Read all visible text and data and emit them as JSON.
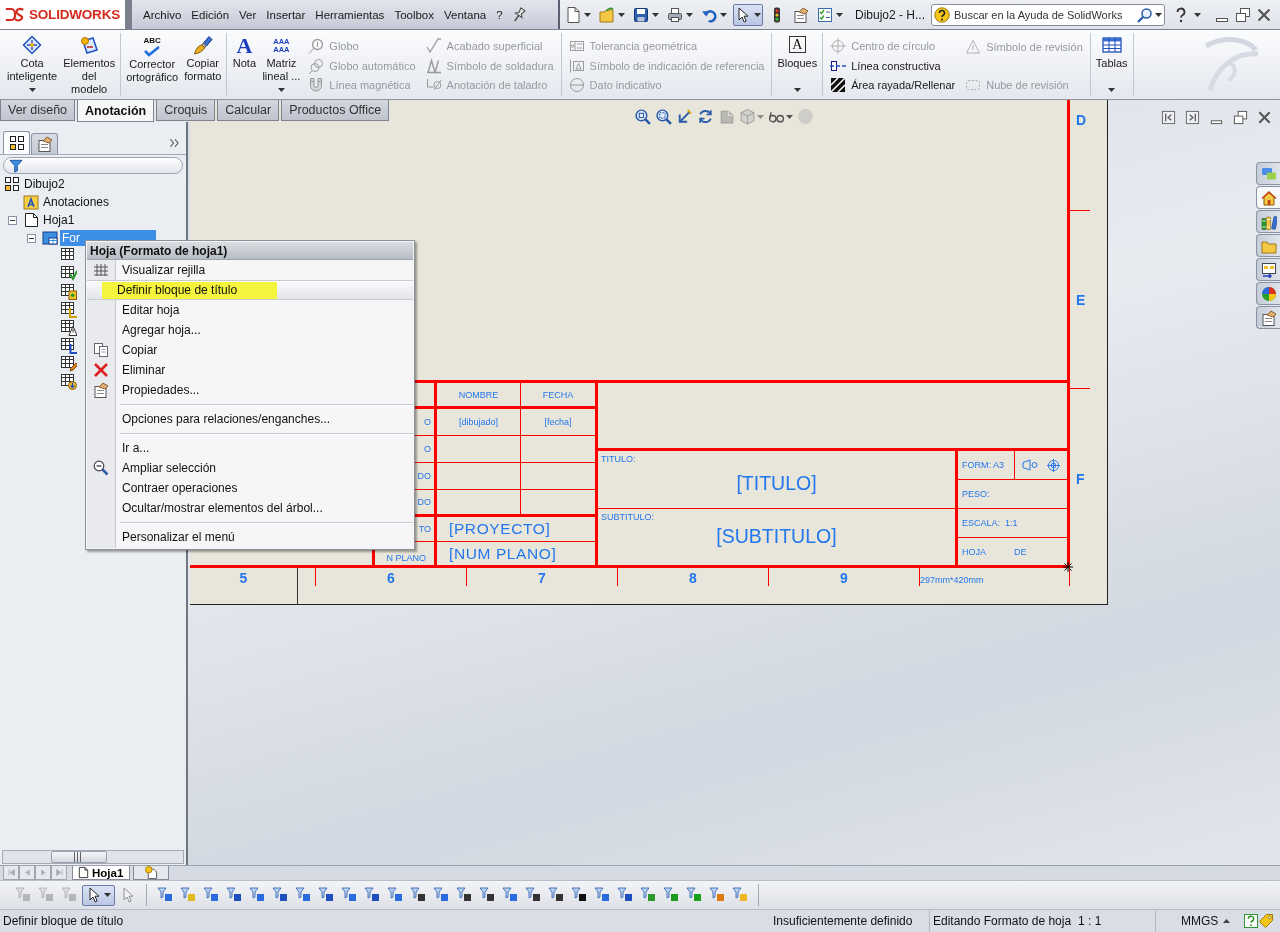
{
  "title_bar": {
    "logo": "SOLIDWORKS",
    "menu": [
      "Archivo",
      "Edición",
      "Ver",
      "Insertar",
      "Herramientas",
      "Toolbox",
      "Ventana",
      "?"
    ],
    "quick_access": [
      {
        "kind": "new",
        "dropdown": true,
        "on": false
      },
      {
        "kind": "open",
        "dropdown": true,
        "on": false
      },
      {
        "kind": "save",
        "dropdown": true,
        "on": false
      },
      {
        "kind": "print",
        "dropdown": true,
        "on": false
      },
      {
        "kind": "undo",
        "dropdown": true,
        "on": false
      },
      {
        "kind": "select",
        "dropdown": true,
        "on": true
      },
      {
        "kind": "traffic_light",
        "dropdown": false,
        "on": false
      },
      {
        "kind": "options",
        "dropdown": false,
        "on": false
      },
      {
        "kind": "checklist",
        "dropdown": true,
        "on": false
      }
    ],
    "document_title": "Dibujo2 - H...",
    "search": {
      "placeholder": "Buscar en la Ayuda de SolidWorks"
    }
  },
  "ribbon": {
    "groups": [
      {
        "buttons": [
          {
            "kind": "smart_dimension",
            "lines": [
              "Cota",
              "inteligente"
            ],
            "dropdown": true
          },
          {
            "kind": "model_items",
            "lines": [
              "Elementos",
              "del",
              "modelo"
            ],
            "dropdown": false
          }
        ]
      },
      {
        "buttons": [
          {
            "kind": "spell_check",
            "glyph": [
              "ABC"
            ],
            "lines": [
              "Corrector",
              "ortográfico"
            ],
            "dropdown": false
          },
          {
            "kind": "format_painter",
            "lines": [
              "Copiar",
              "formato"
            ],
            "dropdown": false
          }
        ]
      },
      {
        "buttons": [
          {
            "kind": "note",
            "glyph": [
              "A"
            ],
            "lines": [
              "Nota"
            ],
            "dropdown": false
          },
          {
            "kind": "pattern",
            "glyph": [
              "AAA",
              "AAA"
            ],
            "lines": [
              "Matriz",
              "lineal ..."
            ],
            "dropdown": true
          }
        ],
        "columns": [
          [
            {
              "kind": "balloon",
              "label": "Globo",
              "disabled": true
            },
            {
              "kind": "auto_balloon",
              "label": "Globo automático",
              "disabled": true
            },
            {
              "kind": "magnetic_line",
              "label": "Línea magnética",
              "disabled": true
            }
          ],
          [
            {
              "kind": "surface_finish",
              "label": "Acabado superficial",
              "disabled": true
            },
            {
              "kind": "weld",
              "label": "Símbolo de soldadura",
              "disabled": true
            },
            {
              "kind": "hole_callout",
              "label": "Anotación de taladro",
              "disabled": true
            }
          ]
        ]
      },
      {
        "columns": [
          [
            {
              "kind": "tolerance",
              "label": "Tolerancia geométrica",
              "disabled": true
            },
            {
              "kind": "datum",
              "label": "Símbolo de indicación de referencia",
              "disabled": true
            },
            {
              "kind": "datum_target",
              "label": "Dato indicativo",
              "disabled": true
            }
          ]
        ]
      },
      {
        "buttons": [
          {
            "kind": "blocks",
            "glyph": [
              "A"
            ],
            "lines": [
              "Bloques"
            ],
            "dropdown": true
          }
        ]
      },
      {
        "columns": [
          [
            {
              "kind": "center_mark",
              "label": "Centro de círculo",
              "disabled": true
            },
            {
              "kind": "centerline",
              "label": "Línea constructiva",
              "disabled": false
            },
            {
              "kind": "hatch",
              "label": "Área rayada/Rellenar",
              "disabled": false
            }
          ],
          [
            {
              "kind": "revision_symbol",
              "label": "Símbolo de revisión",
              "disabled": true
            },
            {
              "kind": "revision_cloud",
              "label": "Nube de revisión",
              "disabled": true
            }
          ]
        ]
      },
      {
        "buttons": [
          {
            "kind": "tables",
            "lines": [
              "Tablas"
            ],
            "dropdown": true
          }
        ]
      }
    ]
  },
  "command_tabs": [
    {
      "label": "Ver diseño",
      "selected": false
    },
    {
      "label": "Anotación",
      "selected": true
    },
    {
      "label": "Croquis",
      "selected": false
    },
    {
      "label": "Calcular",
      "selected": false
    },
    {
      "label": "Productos Office",
      "selected": false
    }
  ],
  "feature_manager": {
    "tabs": [
      {
        "kind": "tree",
        "selected": true
      },
      {
        "kind": "properties",
        "selected": false
      }
    ],
    "tree": [
      {
        "kind": "drawing",
        "label": "Dibujo2",
        "selected": false,
        "children": [
          {
            "kind": "annotations",
            "label": "Anotaciones",
            "selected": false
          },
          {
            "kind": "sheet",
            "label": "Hoja1",
            "selected": false,
            "expanded": true,
            "children": [
              {
                "kind": "sheet_format",
                "label": "For",
                "selected": true,
                "expanded": true,
                "children": [
                  {
                    "kind": "table",
                    "selected": false
                  },
                  {
                    "kind": "table_check",
                    "selected": false
                  },
                  {
                    "kind": "table_box",
                    "selected": false
                  },
                  {
                    "kind": "table_chart",
                    "selected": false
                  },
                  {
                    "kind": "table_warning",
                    "selected": false
                  },
                  {
                    "kind": "table_angle",
                    "selected": false
                  },
                  {
                    "kind": "table_pencil",
                    "selected": false
                  },
                  {
                    "kind": "table_arrow",
                    "selected": false
                  }
                ]
              }
            ]
          }
        ]
      }
    ]
  },
  "context_menu": {
    "title": "Hoja (Formato de hoja1)",
    "items": [
      {
        "kind": "grid",
        "label": "Visualizar rejilla",
        "selected": false,
        "marked": false
      },
      {
        "kind": "plain",
        "label": "Definir bloque de título",
        "selected": true,
        "marked": true
      },
      {
        "kind": "plain",
        "label": "Editar hoja",
        "selected": false,
        "marked": false
      },
      {
        "kind": "plain",
        "label": "Agregar hoja...",
        "selected": false,
        "marked": false
      },
      {
        "kind": "copy",
        "label": "Copiar",
        "selected": false,
        "marked": false
      },
      {
        "kind": "delete",
        "label": "Eliminar",
        "selected": false,
        "marked": false
      },
      {
        "kind": "properties",
        "label": "Propiedades...",
        "selected": false,
        "marked": false
      },
      {
        "kind": "separator"
      },
      {
        "kind": "plain",
        "label": "Opciones para relaciones/enganches...",
        "selected": false,
        "marked": false
      },
      {
        "kind": "separator"
      },
      {
        "kind": "plain",
        "label": "Ir a...",
        "selected": false,
        "marked": false
      },
      {
        "kind": "zoom",
        "label": "Ampliar selección",
        "selected": false,
        "marked": false
      },
      {
        "kind": "plain",
        "label": "Contraer operaciones",
        "selected": false,
        "marked": false
      },
      {
        "kind": "plain",
        "label": "Ocultar/mostrar elementos del árbol...",
        "selected": false,
        "marked": false
      },
      {
        "kind": "separator"
      },
      {
        "kind": "plain",
        "label": "Personalizar el menú",
        "selected": false,
        "marked": false
      }
    ]
  },
  "graphics": {
    "view_toolbar": [
      {
        "kind": "zoom_fit",
        "dropdown": false,
        "disabled": false
      },
      {
        "kind": "zoom_area",
        "dropdown": false,
        "disabled": false
      },
      {
        "kind": "previous_view",
        "dropdown": false,
        "disabled": false
      },
      {
        "kind": "rebuild",
        "dropdown": false,
        "disabled": false
      },
      {
        "kind": "display_style",
        "dropdown": false,
        "disabled": true
      },
      {
        "kind": "view_orientation",
        "dropdown": true,
        "disabled": true
      },
      {
        "kind": "hide_show",
        "dropdown": true,
        "disabled": false
      },
      {
        "kind": "appearance",
        "dropdown": false,
        "disabled": true
      }
    ],
    "sheet": {
      "zone_letters": [
        "D",
        "E",
        "F"
      ],
      "zone_numbers": [
        "5",
        "6",
        "7",
        "8",
        "9"
      ],
      "size": "297mm*420mm",
      "title_block": {
        "headers": [
          "NOMBRE",
          "FECHA"
        ],
        "rows": [
          {
            "label": "O",
            "values": [
              "[dibujado]",
              "[fecha]"
            ]
          },
          {
            "label": "O"
          },
          {
            "label": "DO"
          },
          {
            "label": "DO"
          }
        ],
        "project": {
          "label": "TO",
          "value": "[PROYECTO]"
        },
        "drawing_number": {
          "label": "N PLANO",
          "value": "[NUM PLANO]"
        },
        "title": {
          "label": "TITULO:",
          "value": "[TITULO]"
        },
        "subtitle": {
          "label": "SUBTITULO:",
          "value": "[SUBTITULO]"
        },
        "format": "FORM: A3",
        "weight": "PESO:",
        "scale": "ESCALA:  1:1",
        "sheet": [
          "HOJA",
          "DE"
        ]
      }
    },
    "task_pane": [
      {
        "kind": "resources",
        "selected": false
      },
      {
        "kind": "home",
        "selected": true
      },
      {
        "kind": "library",
        "selected": false
      },
      {
        "kind": "explorer",
        "selected": false
      },
      {
        "kind": "view_palette",
        "selected": false
      },
      {
        "kind": "appearances",
        "selected": false
      },
      {
        "kind": "properties",
        "selected": false
      }
    ]
  },
  "sheet_tabs": {
    "navigation_disabled": true,
    "tabs": [
      {
        "label": "Hoja1",
        "selected": true
      }
    ]
  },
  "selection_toolbar": [
    {
      "kind": "filter",
      "disabled": true,
      "on": false
    },
    {
      "kind": "filter",
      "disabled": true,
      "on": false
    },
    {
      "kind": "filter",
      "disabled": true,
      "on": false
    },
    {
      "kind": "select",
      "disabled": false,
      "on": true
    },
    {
      "kind": "pointer",
      "disabled": true,
      "on": false
    },
    {
      "kind": "filter",
      "disabled": false,
      "on": false
    },
    {
      "kind": "filter",
      "disabled": false,
      "on": false
    },
    {
      "kind": "filter",
      "disabled": false,
      "on": false
    },
    {
      "kind": "filter",
      "disabled": false,
      "on": false
    },
    {
      "kind": "filter",
      "disabled": false,
      "on": false
    },
    {
      "kind": "filter",
      "disabled": false,
      "on": false
    },
    {
      "kind": "filter",
      "disabled": false,
      "on": false
    },
    {
      "kind": "filter",
      "disabled": false,
      "on": false
    },
    {
      "kind": "filter",
      "disabled": false,
      "on": false
    },
    {
      "kind": "filter",
      "disabled": false,
      "on": false
    },
    {
      "kind": "filter",
      "disabled": false,
      "on": false
    },
    {
      "kind": "filter",
      "disabled": false,
      "on": false
    },
    {
      "kind": "filter",
      "disabled": false,
      "on": false
    },
    {
      "kind": "filter",
      "disabled": false,
      "on": false
    },
    {
      "kind": "filter",
      "disabled": false,
      "on": false
    },
    {
      "kind": "filter",
      "disabled": false,
      "on": false
    },
    {
      "kind": "filter",
      "disabled": false,
      "on": false
    },
    {
      "kind": "filter",
      "disabled": false,
      "on": false
    },
    {
      "kind": "filter",
      "disabled": false,
      "on": false
    },
    {
      "kind": "filter",
      "disabled": false,
      "on": false
    },
    {
      "kind": "filter",
      "disabled": false,
      "on": false
    },
    {
      "kind": "filter",
      "disabled": false,
      "on": false
    },
    {
      "kind": "filter",
      "disabled": false,
      "on": false
    },
    {
      "kind": "filter",
      "disabled": false,
      "on": false
    },
    {
      "kind": "filter",
      "disabled": false,
      "on": false
    },
    {
      "kind": "filter",
      "disabled": false,
      "on": false
    }
  ],
  "status_bar": {
    "message": "Definir bloque de título",
    "fields": [
      "Insuficientemente definido",
      "Editando Formato de hoja",
      "1 : 1",
      "MMGS"
    ]
  }
}
